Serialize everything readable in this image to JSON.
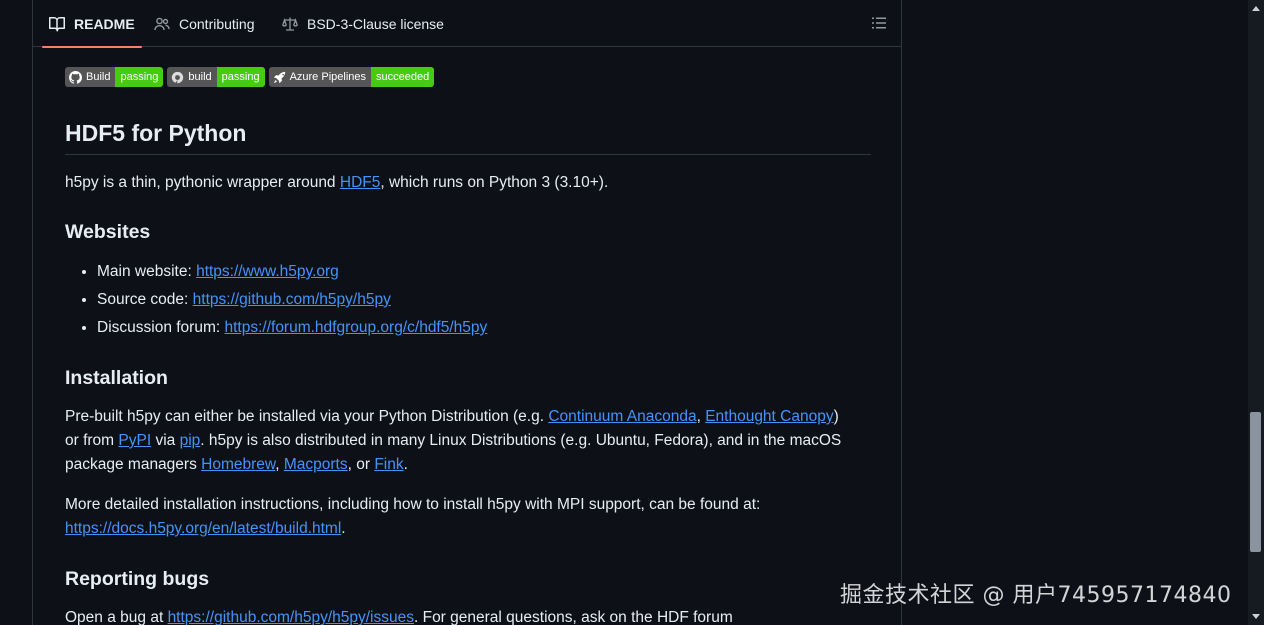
{
  "tabs": [
    {
      "label": "README",
      "icon": "book-icon",
      "active": true
    },
    {
      "label": "Contributing",
      "icon": "people-icon",
      "active": false
    },
    {
      "label": "BSD-3-Clause license",
      "icon": "law-icon",
      "active": false
    }
  ],
  "toc_icon": "list-icon",
  "badges": [
    {
      "label": "Build",
      "value": "passing",
      "icon": "github-icon"
    },
    {
      "label": "build",
      "value": "passing",
      "icon": "appveyor-icon"
    },
    {
      "label": "Azure Pipelines",
      "value": "succeeded",
      "icon": "rocket-icon"
    }
  ],
  "colors": {
    "background": "#0d1117",
    "text": "#e6edf3",
    "link": "#4493f8",
    "active_tab_underline": "#f78166",
    "badge_label": "#555555",
    "badge_value": "#44cc11",
    "border": "#30363d"
  },
  "readme": {
    "title": "HDF5 for Python",
    "intro": {
      "before": "h5py is a thin, pythonic wrapper around ",
      "link": "HDF5",
      "after": ", which runs on Python 3 (3.10+)."
    },
    "websites": {
      "heading": "Websites",
      "items": [
        {
          "label": "Main website: ",
          "url": "https://www.h5py.org"
        },
        {
          "label": "Source code: ",
          "url": "https://github.com/h5py/h5py"
        },
        {
          "label": "Discussion forum: ",
          "url": "https://forum.hdfgroup.org/c/hdf5/h5py"
        }
      ]
    },
    "installation": {
      "heading": "Installation",
      "p1": {
        "t1": "Pre-built h5py can either be installed via your Python Distribution (e.g. ",
        "l1": "Continuum Anaconda",
        "t2": ", ",
        "l2": "Enthought Canopy",
        "t3": ")",
        "t4": "or from ",
        "l3": "PyPI",
        "t5": " via ",
        "l4": "pip",
        "t6": ". h5py is also distributed in many Linux Distributions (e.g. Ubuntu, Fedora), and in the macOS",
        "t7": "package managers ",
        "l5": "Homebrew",
        "t8": ", ",
        "l6": "Macports",
        "t9": ", or ",
        "l7": "Fink",
        "t10": "."
      },
      "p2": {
        "text": "More detailed installation instructions, including how to install h5py with MPI support, can be found at:",
        "link": "https://docs.h5py.org/en/latest/build.html",
        "after": "."
      }
    },
    "bugs": {
      "heading": "Reporting bugs",
      "before": "Open a bug at ",
      "link": "https://github.com/h5py/h5py/issues",
      "after": ". For general questions, ask on the HDF forum"
    }
  },
  "watermark": "掘金技术社区 @ 用户745957174840"
}
